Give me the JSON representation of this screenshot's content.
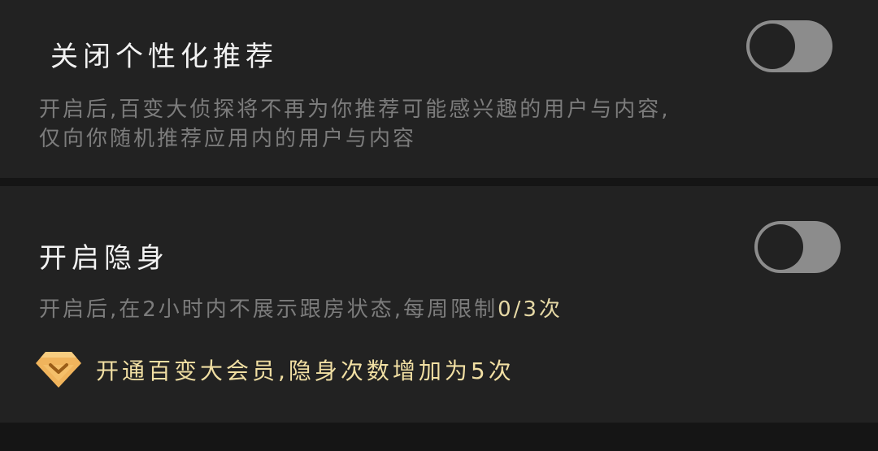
{
  "personalization": {
    "title": "关闭个性化推荐",
    "desc_line1": "开启后,百变大侦探将不再为你推荐可能感兴趣的用户与内容,",
    "desc_line2": "仅向你随机推荐应用内的用户与内容",
    "toggle_on": false
  },
  "stealth": {
    "title": "开启隐身",
    "desc_prefix": "开启后,在2小时内不展示跟房状态,每周限制",
    "desc_count": "0/3次",
    "toggle_on": false,
    "vip_icon": "vip-diamond-icon",
    "vip_text": "开通百变大会员,隐身次数增加为5次"
  },
  "colors": {
    "background": "#151515",
    "card": "#222222",
    "toggle_track": "#8c8c8c",
    "vip_gold": "#f0b45c",
    "vip_text": "#f1dfa3"
  }
}
